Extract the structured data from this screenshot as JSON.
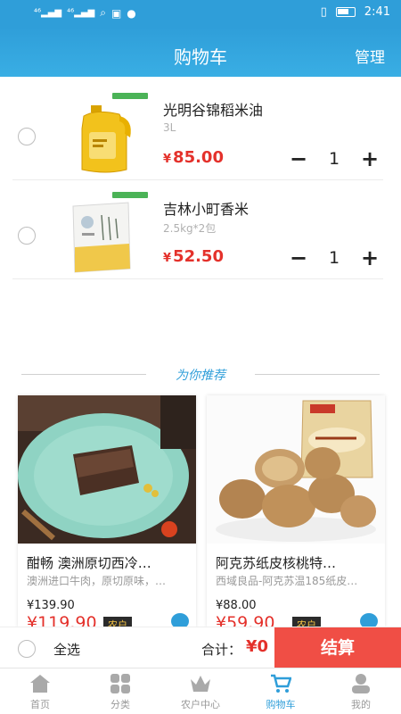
{
  "status": {
    "network1": "⁴⁶",
    "network2": "⁴⁶",
    "time": "2:41"
  },
  "header": {
    "title": "购物车",
    "manage_label": "管理"
  },
  "cart_items": [
    {
      "name": "光明谷锦稻米油",
      "spec": "3L",
      "currency": "¥",
      "price": "85.00",
      "minus": "−",
      "qty": "1",
      "plus": "+"
    },
    {
      "name": "吉林小町香米",
      "spec": "2.5kg*2包",
      "currency": "¥",
      "price": "52.50",
      "minus": "−",
      "qty": "1",
      "plus": "+"
    }
  ],
  "recommend": {
    "title": "为你推荐"
  },
  "products": [
    {
      "name": "酣畅 澳洲原切西冷…",
      "desc": "澳洲进口牛肉，原切原味，…",
      "price": "¥139.90",
      "price2": "¥119.90",
      "tag": "农户"
    },
    {
      "name": "阿克苏纸皮核桃特…",
      "desc": "西域良品-阿克苏温185纸皮…",
      "price": "¥88.00",
      "price2": "¥59.90",
      "tag": "农户"
    }
  ],
  "bottom": {
    "select_all": "全选",
    "total_label": "合计：",
    "total_value": "¥0",
    "checkout": "结算"
  },
  "tabs": [
    {
      "label": "首页",
      "icon": "home-icon"
    },
    {
      "label": "分类",
      "icon": "category-icon"
    },
    {
      "label": "农户中心",
      "icon": "crown-icon"
    },
    {
      "label": "购物车",
      "icon": "cart-icon",
      "active": true
    },
    {
      "label": "我的",
      "icon": "user-icon"
    }
  ],
  "colors": {
    "accent": "#2f9ed9",
    "price": "#e4312b",
    "checkout": "#f04e45"
  }
}
